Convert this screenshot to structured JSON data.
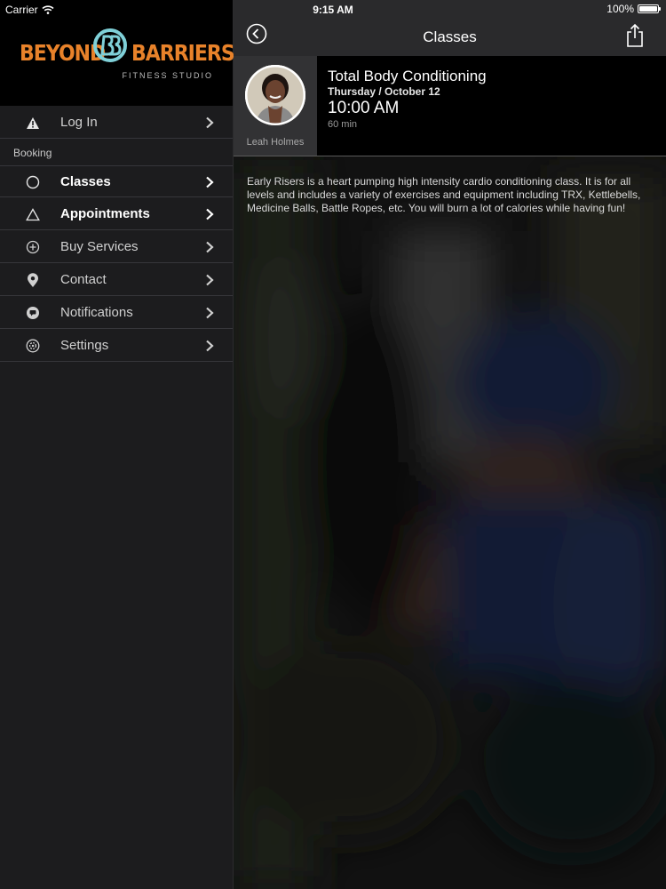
{
  "status_bar": {
    "carrier": "Carrier",
    "time": "9:15 AM",
    "battery": "100%",
    "battery_level": 1.0
  },
  "sidebar": {
    "logo": {
      "word_left": "BEYOND",
      "word_right": "BARRIERS",
      "tagline": "FITNESS STUDIO",
      "brand_color": "#e8822a",
      "mark_color": "#7fd0d8"
    },
    "login": {
      "label": "Log In",
      "icon": "warning-icon"
    },
    "section_header": "Booking",
    "items": [
      {
        "label": "Classes",
        "icon": "circle-icon"
      },
      {
        "label": "Appointments",
        "icon": "triangle-icon"
      },
      {
        "label": "Buy Services",
        "icon": "plus-circle-icon"
      },
      {
        "label": "Contact",
        "icon": "location-pin-icon"
      },
      {
        "label": "Notifications",
        "icon": "chat-bubble-icon"
      },
      {
        "label": "Settings",
        "icon": "gear-icon"
      }
    ]
  },
  "header": {
    "title": "Classes",
    "back_icon": "back-arrow-icon",
    "share_icon": "share-icon"
  },
  "class_detail": {
    "instructor": "Leah Holmes",
    "name": "Total Body Conditioning",
    "date": "Thursday / October 12",
    "time": "10:00 AM",
    "duration": "60 min",
    "description": "Early Risers is a heart pumping high intensity cardio conditioning class.  It is for all levels and includes a variety of exercises and equipment including TRX, Kettlebells, Medicine Balls, Battle Ropes, etc. You will burn a lot of calories while having fun!"
  }
}
